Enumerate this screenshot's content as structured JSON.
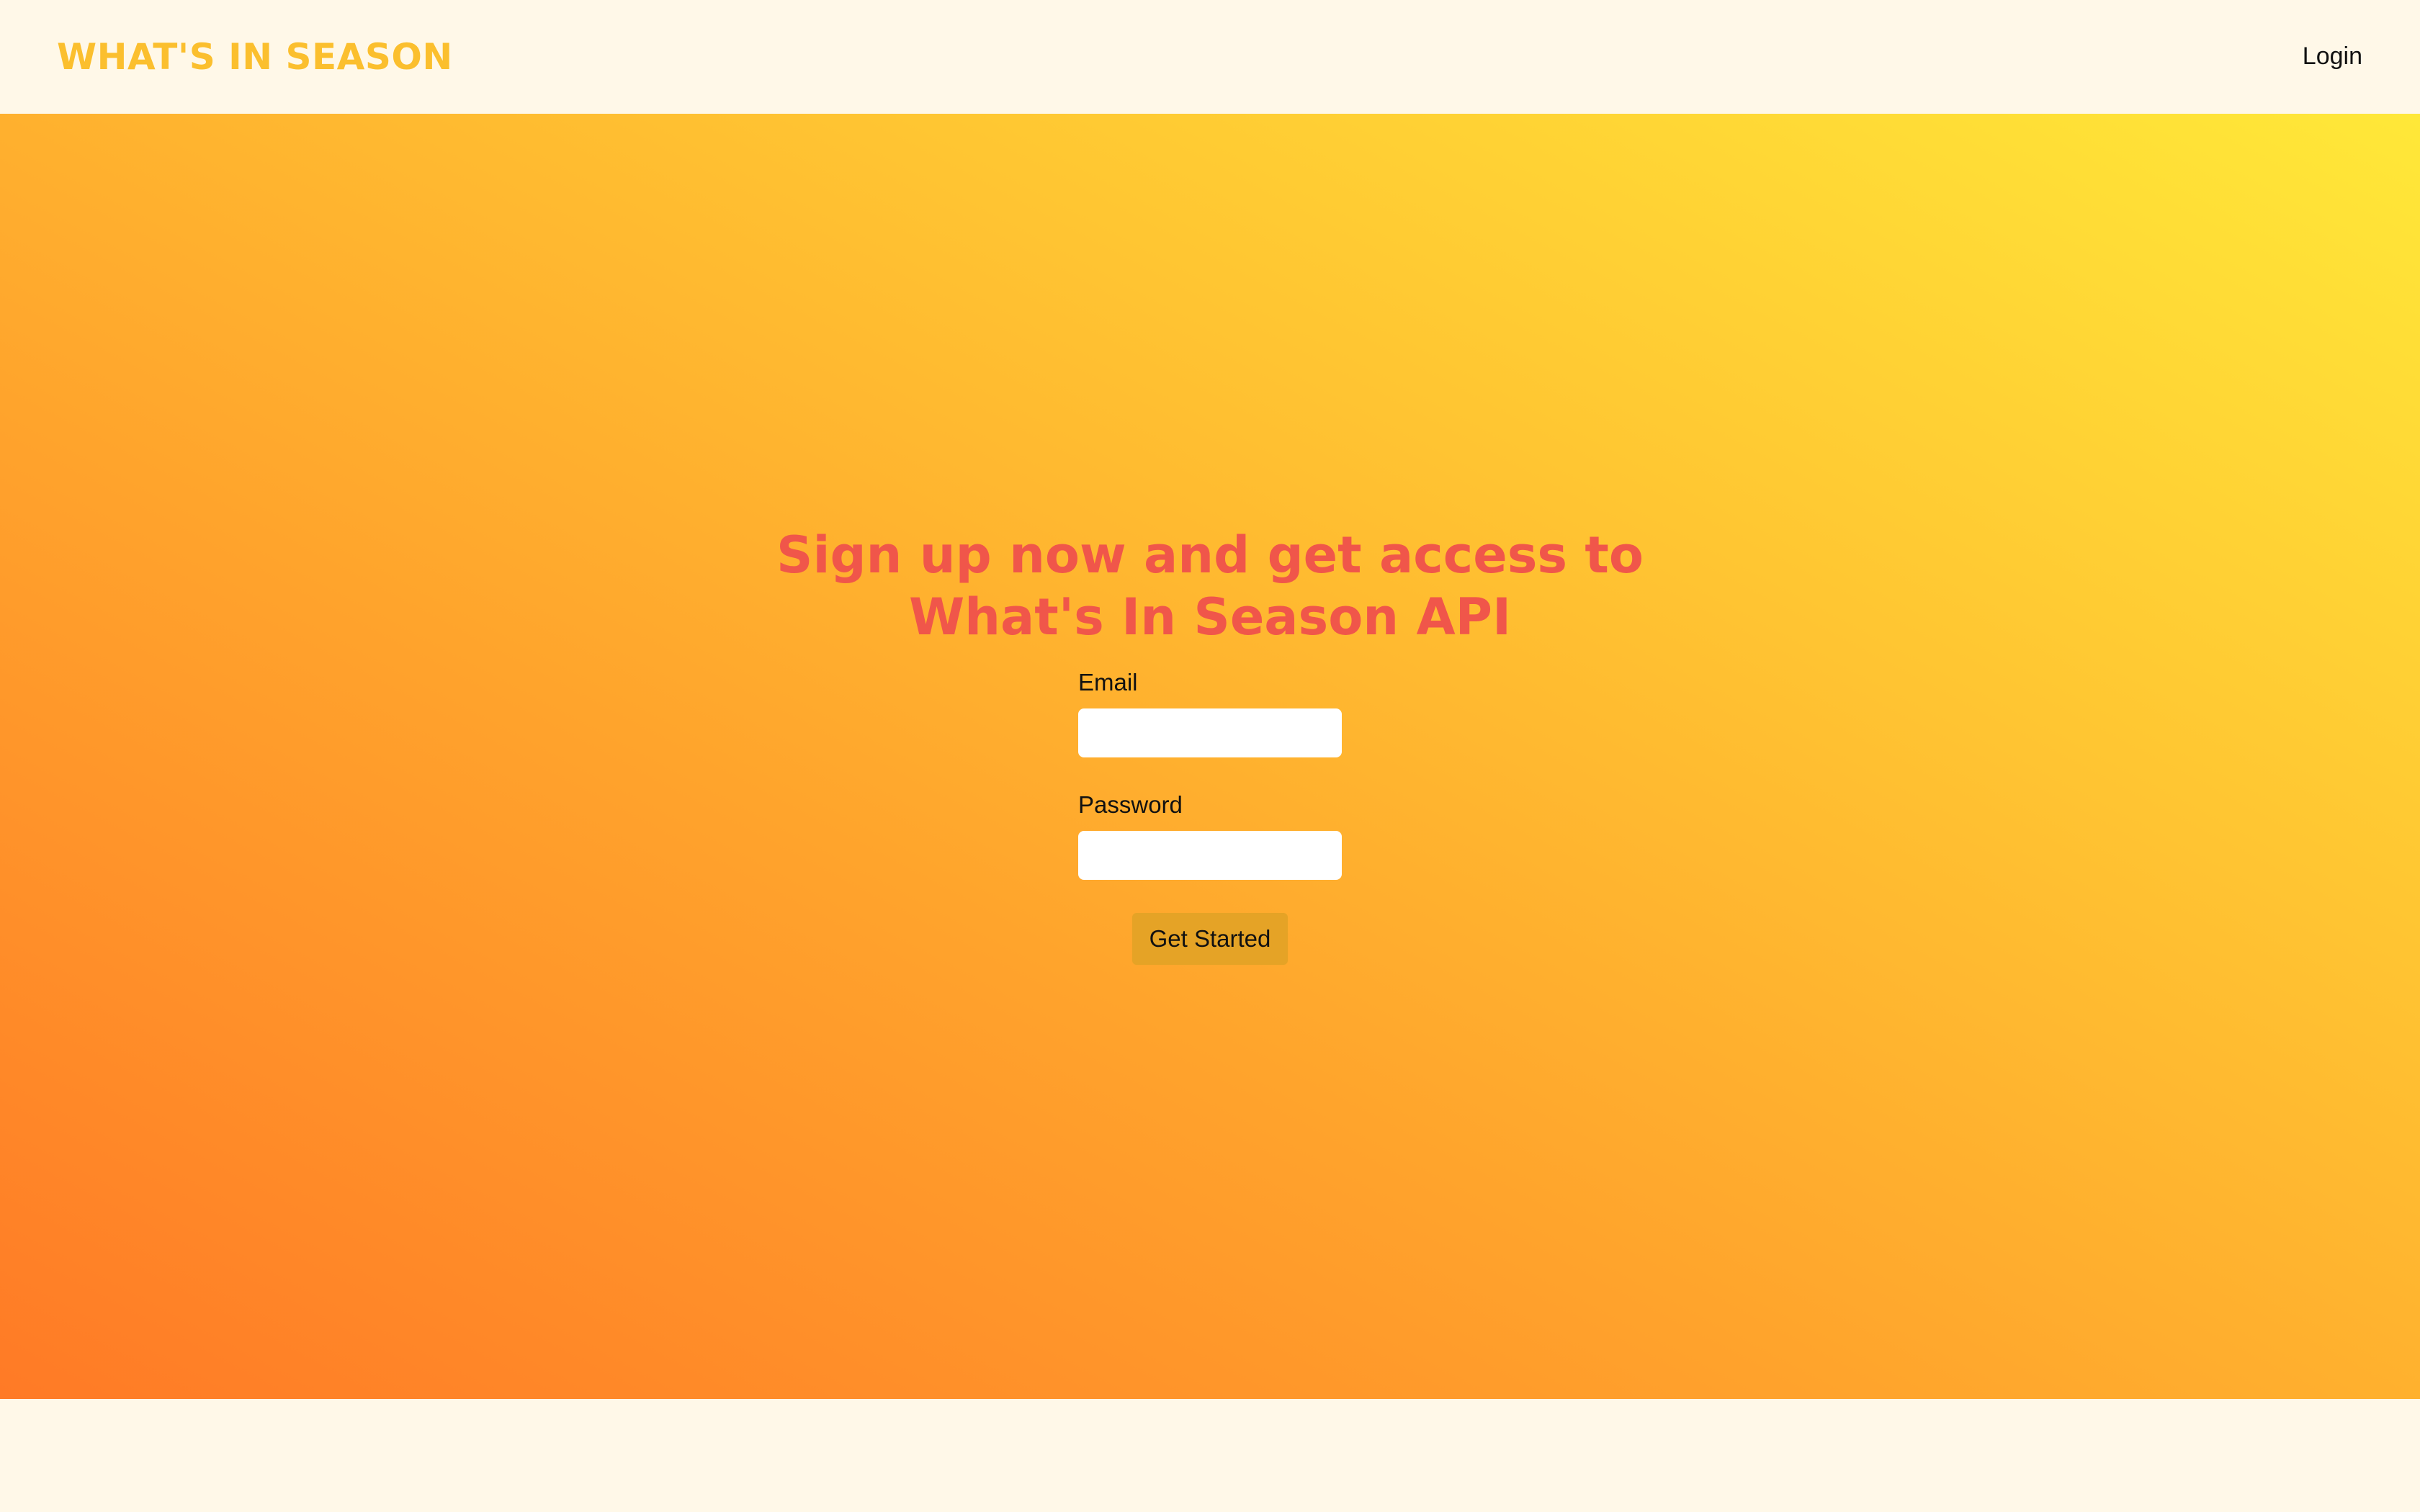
{
  "navbar": {
    "logo": "WHAT'S IN SEASON",
    "login_label": "Login"
  },
  "hero": {
    "headline_line1": "Sign up now and get access to",
    "headline_line2": "What's In Season API"
  },
  "form": {
    "email_label": "Email",
    "email_value": "",
    "password_label": "Password",
    "password_value": "",
    "submit_label": "Get Started"
  },
  "colors": {
    "logo": "#fbbf2e",
    "headline": "#f0564a",
    "page_background": "#fff8e8",
    "gradient_start": "#ff7a26",
    "gradient_end": "#ffe838",
    "button": "#e5a326"
  }
}
